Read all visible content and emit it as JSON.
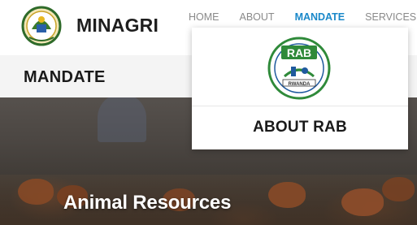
{
  "header": {
    "brand": "MINAGRI",
    "logo_icon": "coat-of-arms-icon",
    "nav": [
      {
        "label": "HOME",
        "active": false
      },
      {
        "label": "ABOUT",
        "active": false
      },
      {
        "label": "MANDATE",
        "active": true
      },
      {
        "label": "SERVICES",
        "active": false
      }
    ],
    "accent_color": "#1a88c9"
  },
  "title_bar": {
    "title": "MANDATE"
  },
  "hero": {
    "title": "Animal Resources"
  },
  "dropdown": {
    "logo_text": "RAB",
    "logo_caption": "RWANDA",
    "logo_icon": "rab-logo-icon",
    "link": "ABOUT RAB"
  }
}
